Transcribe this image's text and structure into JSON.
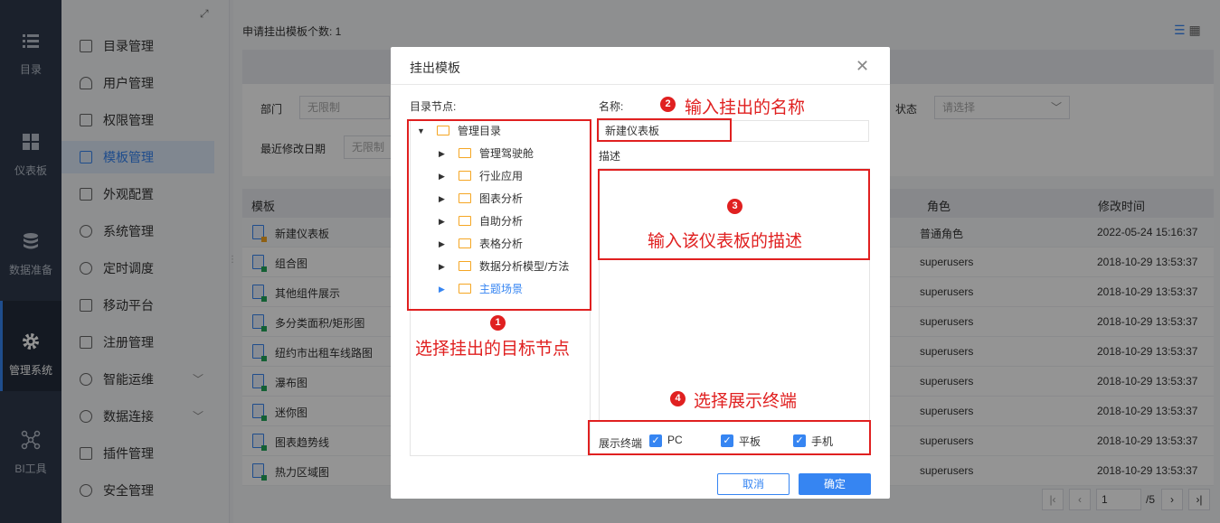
{
  "leftnav": [
    {
      "label": "目录",
      "icon": "list-icon"
    },
    {
      "label": "仪表板",
      "icon": "dashboard-icon"
    },
    {
      "label": "数据准备",
      "icon": "database-icon"
    },
    {
      "label": "管理系统",
      "icon": "gear-icon",
      "active": true
    },
    {
      "label": "BI工具",
      "icon": "network-icon"
    }
  ],
  "sidemenu": [
    "目录管理",
    "用户管理",
    "权限管理",
    "模板管理",
    "外观配置",
    "系统管理",
    "定时调度",
    "移动平台",
    "注册管理",
    "智能运维",
    "数据连接",
    "插件管理",
    "安全管理"
  ],
  "main": {
    "count_text": "申请挂出模板个数: 1",
    "filters": {
      "dept_label": "部门",
      "dept_placeholder": "无限制",
      "status_label": "状态",
      "status_placeholder": "请选择",
      "date_label": "最近修改日期",
      "date_placeholder": "无限制"
    },
    "columns": [
      "模板",
      "角色",
      "修改时间"
    ],
    "rows": [
      {
        "name": "新建仪表板",
        "role": "普通角色",
        "time": "2022-05-24 15:16:37"
      },
      {
        "name": "组合图",
        "role": "superusers",
        "time": "2018-10-29 13:53:37"
      },
      {
        "name": "其他组件展示",
        "role": "superusers",
        "time": "2018-10-29 13:53:37"
      },
      {
        "name": "多分类面积/矩形图",
        "role": "superusers",
        "time": "2018-10-29 13:53:37"
      },
      {
        "name": "纽约市出租车线路图",
        "role": "superusers",
        "time": "2018-10-29 13:53:37"
      },
      {
        "name": "瀑布图",
        "role": "superusers",
        "time": "2018-10-29 13:53:37"
      },
      {
        "name": "迷你图",
        "role": "superusers",
        "time": "2018-10-29 13:53:37"
      },
      {
        "name": "图表趋势线",
        "role": "superusers",
        "time": "2018-10-29 13:53:37"
      },
      {
        "name": "热力区域图",
        "role": "superusers",
        "time": "2018-10-29 13:53:37"
      }
    ],
    "pager": {
      "page": "1",
      "total": "/5"
    }
  },
  "dialog": {
    "title": "挂出模板",
    "tree_label": "目录节点:",
    "tree": {
      "root": "管理目录",
      "children": [
        "管理驾驶舱",
        "行业应用",
        "图表分析",
        "自助分析",
        "表格分析",
        "数据分析模型/方法",
        "主题场景"
      ]
    },
    "name_label": "名称:",
    "name_value": "新建仪表板",
    "desc_label": "描述",
    "terminal_label": "展示终端",
    "terminals": [
      "PC",
      "平板",
      "手机"
    ],
    "cancel": "取消",
    "confirm": "确定"
  },
  "annotations": {
    "n1": "1",
    "a1": "选择挂出的目标节点",
    "n2": "2",
    "a2": "输入挂出的名称",
    "n3": "3",
    "a3": "输入该仪表板的描述",
    "n4": "4",
    "a4": "选择展示终端"
  }
}
